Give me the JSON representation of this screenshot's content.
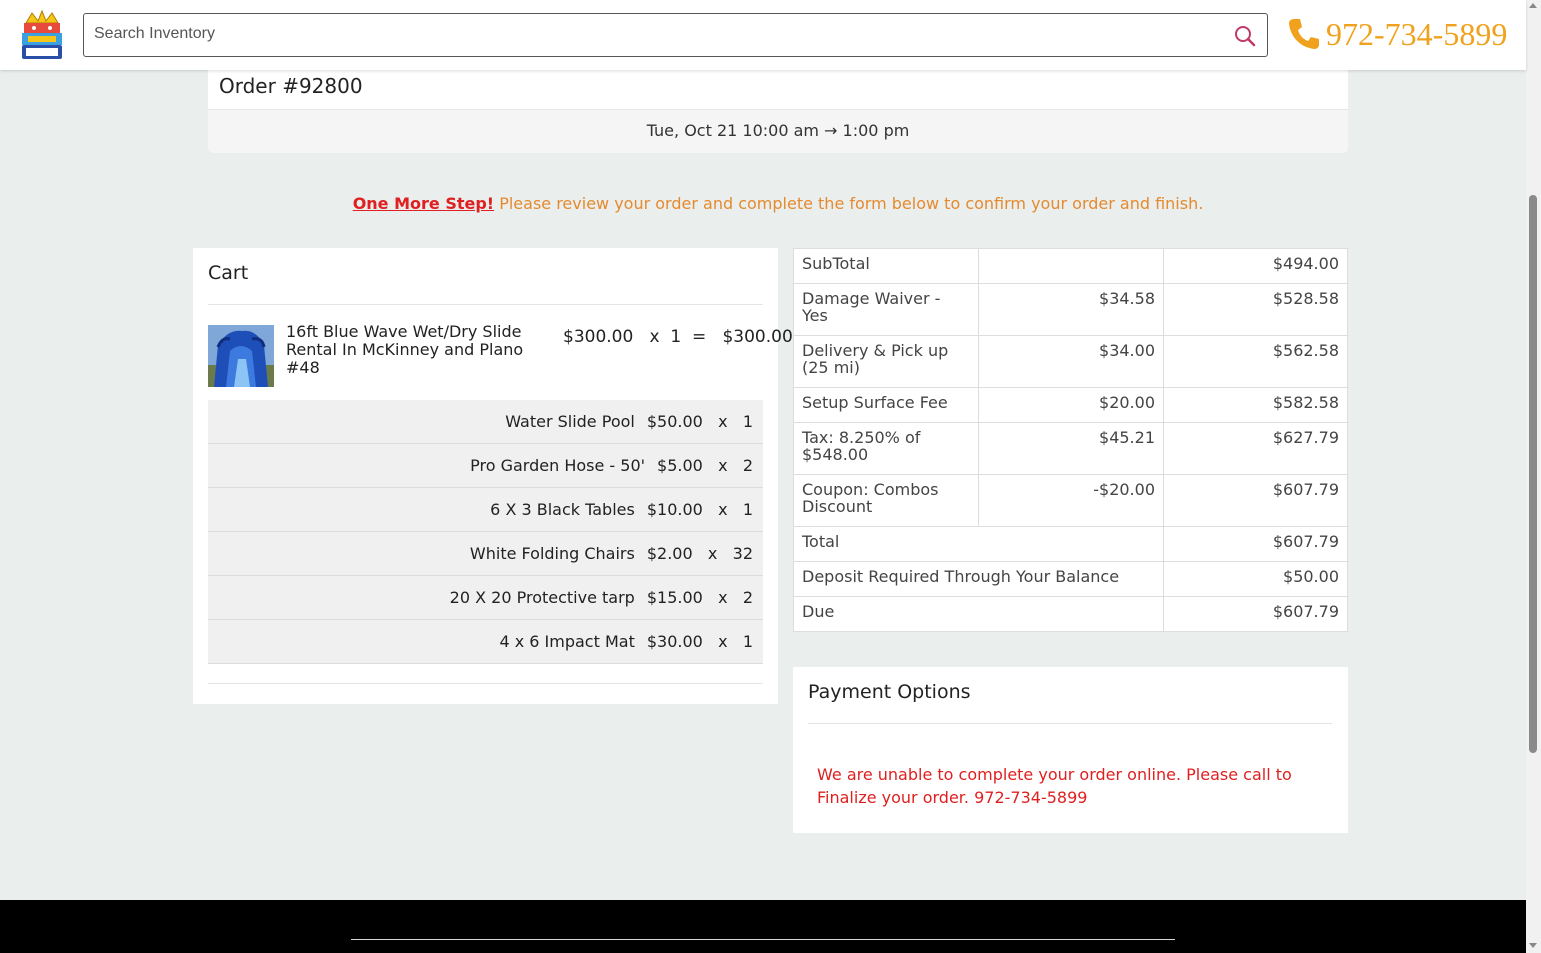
{
  "header": {
    "search_placeholder": "Search Inventory",
    "phone": "972-734-5899",
    "phone_color": "#f0a21e",
    "logo_icon": "bouncy-kingdom-logo",
    "search_icon": "magnifier-icon",
    "phone_icon": "phone-handset-icon"
  },
  "order": {
    "title": "Order #92800",
    "datetime": "Tue, Oct 21 10:00 am → 1:00 pm"
  },
  "notice": {
    "strong": "One More Step!",
    "text": " Please review your order and complete the form below to confirm your order and finish."
  },
  "cart": {
    "title": "Cart",
    "item": {
      "name": "16ft Blue Wave Wet/Dry Slide Rental In McKinney and Plano #48",
      "price_line": "$300.00   x  1  =   $300.00"
    },
    "addons": [
      {
        "name": "Water Slide Pool",
        "qty": "$50.00   x   1"
      },
      {
        "name": "Pro Garden Hose - 50'",
        "qty": "$5.00   x   2"
      },
      {
        "name": "6 X 3 Black Tables",
        "qty": "$10.00   x   1"
      },
      {
        "name": "White Folding Chairs",
        "qty": "$2.00   x   32"
      },
      {
        "name": "20 X 20 Protective tarp",
        "qty": "$15.00   x   2"
      },
      {
        "name": "4 x 6 Impact Mat",
        "qty": "$30.00   x   1"
      }
    ]
  },
  "totals": {
    "subtotal_label": "SubTotal",
    "subtotal_running": "$494.00",
    "rows": [
      {
        "label": "Damage Waiver - Yes",
        "amount": "$34.58",
        "running": "$528.58"
      },
      {
        "label": "Delivery & Pick up (25 mi)",
        "amount": "$34.00",
        "running": "$562.58"
      },
      {
        "label": "Setup Surface Fee",
        "amount": "$20.00",
        "running": "$582.58"
      },
      {
        "label": "Tax: 8.250% of $548.00",
        "amount": "$45.21",
        "running": "$627.79"
      },
      {
        "label": "Coupon: Combos Discount",
        "amount": "-$20.00",
        "running": "$607.79"
      }
    ],
    "total_label": "Total",
    "total_value": "$607.79",
    "deposit_label": "Deposit Required Through Your Balance",
    "deposit_value": "$50.00",
    "due_label": "Due",
    "due_value": "$607.79"
  },
  "payment": {
    "title": "Payment Options",
    "message": "We are unable to complete your order online. Please call to Finalize your order. 972-734-5899"
  }
}
